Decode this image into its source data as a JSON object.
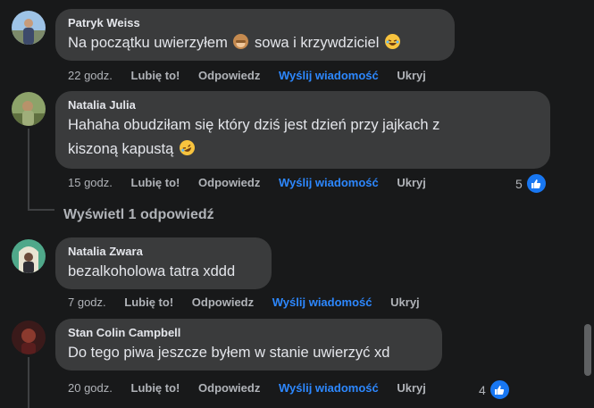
{
  "comments": [
    {
      "author": "Patryk Weiss",
      "text_before": "Na początku uwierzyłem",
      "text_middle": "sowa i krzywdziciel",
      "time": "22 godz.",
      "like": "Lubię to!",
      "reply": "Odpowiedz",
      "message": "Wyślij wiadomość",
      "hide": "Ukryj"
    },
    {
      "author": "Natalia Julia",
      "text_line1": "Hahaha obudziłam się który dziś jest dzień przy jajkach z",
      "text_line2": "kiszoną kapustą",
      "time": "15 godz.",
      "like": "Lubię to!",
      "reply": "Odpowiedz",
      "message": "Wyślij wiadomość",
      "hide": "Ukryj",
      "reaction_count": "5",
      "view_replies": "Wyświetl 1 odpowiedź"
    },
    {
      "author": "Natalia Zwara",
      "text": "bezalkoholowa tatra xddd",
      "time": "7 godz.",
      "like": "Lubię to!",
      "reply": "Odpowiedz",
      "message": "Wyślij wiadomość",
      "hide": "Ukryj"
    },
    {
      "author": "Stan Colin Campbell",
      "text": "Do tego piwa jeszcze byłem w stanie uwierzyć xd",
      "time": "20 godz.",
      "like": "Lubię to!",
      "reply": "Odpowiedz",
      "message": "Wyślij wiadomość",
      "hide": "Ukryj",
      "reaction_count": "4"
    }
  ],
  "colors": {
    "background": "#18191a",
    "bubble": "#3a3b3c",
    "link": "#2d88ff",
    "meta": "#b0b3b8",
    "like_badge": "#1877f2"
  },
  "icons": [
    "see-no-evil-monkey-icon",
    "laughing-face-icon",
    "rolling-laughing-face-icon",
    "thumbs-up-icon"
  ]
}
